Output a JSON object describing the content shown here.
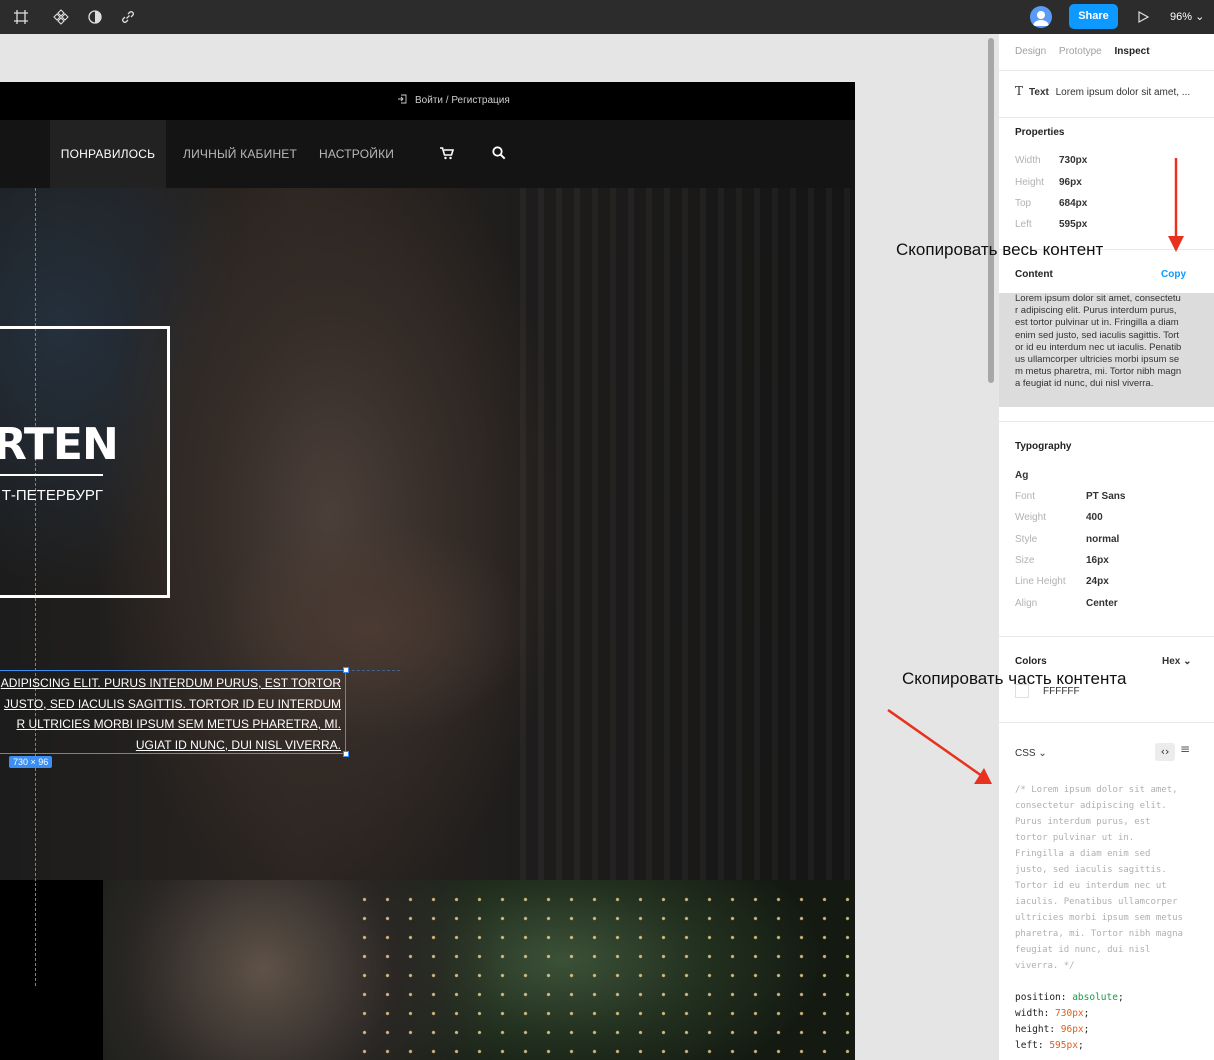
{
  "toolbar": {
    "share_label": "Share",
    "zoom_label": "96% ⌄",
    "icons": [
      "frame-icon",
      "component-icon",
      "contrast-icon",
      "link-icon",
      "play-icon"
    ]
  },
  "site": {
    "login_label": "Войти / Регистрация",
    "nav": [
      "ПОНРАВИЛОСЬ",
      "ЛИЧНЫЙ КАБИНЕТ",
      "НАСТРОЙКИ"
    ],
    "logo_title": "RTEN",
    "logo_city": "Т-ПЕТЕРБУРГ",
    "selected_text_lines": [
      "ADIPISCING ELIT. PURUS INTERDUM PURUS, EST TORTOR",
      "JUSTO, SED IACULIS SAGITTIS. TORTOR ID EU INTERDUM",
      "R ULTRICIES MORBI IPSUM SEM METUS PHARETRA, MI.",
      "UGIAT ID NUNC, DUI NISL VIVERRA."
    ],
    "dimension_badge": "730 × 96"
  },
  "panel": {
    "tabs": [
      "Design",
      "Prototype",
      "Inspect"
    ],
    "layer_type": "Text",
    "layer_name": "Lorem ipsum dolor sit amet, ...",
    "properties_title": "Properties",
    "properties": [
      {
        "label": "Width",
        "value": "730px"
      },
      {
        "label": "Height",
        "value": "96px"
      },
      {
        "label": "Top",
        "value": "684px"
      },
      {
        "label": "Left",
        "value": "595px"
      }
    ],
    "content_title": "Content",
    "copy_label": "Copy",
    "content_text": "Lorem ipsum dolor sit amet, consectetu\nr adipiscing elit. Purus interdum purus,\nest tortor pulvinar ut in. Fringilla a diam\nenim sed justo, sed iaculis sagittis. Tort\nor id eu interdum nec ut iaculis. Penatib\nus ullamcorper ultricies morbi ipsum se\nm metus pharetra, mi. Tortor nibh magn\na feugiat id nunc, dui nisl viverra.",
    "typography_title": "Typography",
    "typography_sample": "Ag",
    "typography": [
      {
        "label": "Font",
        "value": "PT Sans"
      },
      {
        "label": "Weight",
        "value": "400"
      },
      {
        "label": "Style",
        "value": "normal"
      },
      {
        "label": "Size",
        "value": "16px"
      },
      {
        "label": "Line Height",
        "value": "24px"
      },
      {
        "label": "Align",
        "value": "Center"
      }
    ],
    "colors_title": "Colors",
    "colors_format": "Hex ⌄",
    "color_value": "FFFFFF",
    "css_title": "CSS ⌄",
    "css_comment": "/* Lorem ipsum dolor sit amet,\nconsectetur adipiscing elit.\nPurus interdum purus, est\ntortor pulvinar ut in.\nFringilla a diam enim sed\njusto, sed iaculis sagittis.\nTortor id eu interdum nec ut\niaculis. Penatibus ullamcorper\nultricies morbi ipsum sem metus\npharetra, mi. Tortor nibh magna\nfeugiat id nunc, dui nisl\nviverra. */",
    "css_props": [
      {
        "prop": "position: ",
        "value": "absolute",
        "kind": "green"
      },
      {
        "prop": "width: ",
        "value": "730px",
        "kind": "orange"
      },
      {
        "prop": "height: ",
        "value": "96px",
        "kind": "orange"
      },
      {
        "prop": "left: ",
        "value": "595px",
        "kind": "orange"
      }
    ]
  },
  "annotations": {
    "copy_all": "Скопировать весь контент",
    "copy_part": "Скопировать часть контента"
  },
  "colors": {
    "accent": "#0d99ff",
    "selection": "#3b8ff3",
    "arrow": "#e8321f",
    "toolbar": "#2c2c2c"
  }
}
